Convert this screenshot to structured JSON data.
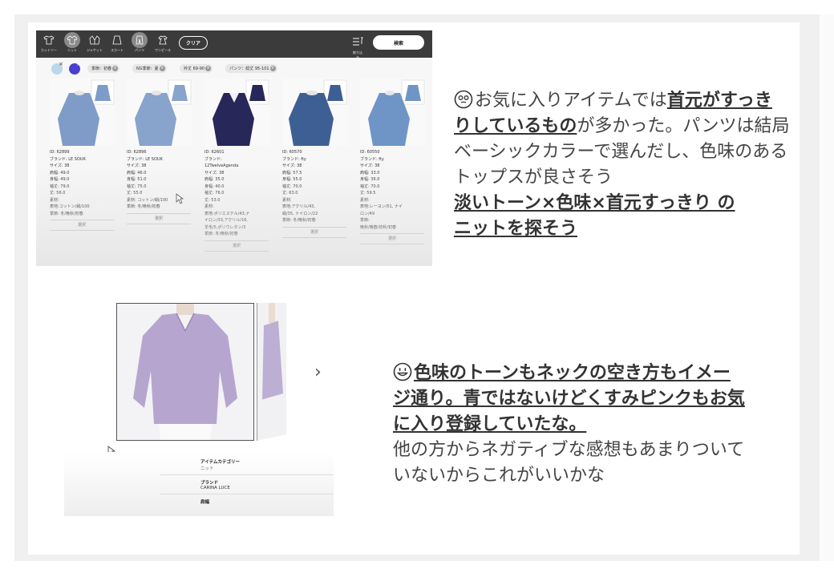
{
  "screenshot1": {
    "categories": [
      {
        "label": "カットソー",
        "icon": "tshirt-icon",
        "on": false
      },
      {
        "label": "ニット",
        "icon": "knit-icon",
        "on": true
      },
      {
        "label": "ジャケット",
        "icon": "jacket-icon",
        "on": false
      },
      {
        "label": "スカート",
        "icon": "skirt-icon",
        "on": false
      },
      {
        "label": "パンツ",
        "icon": "pants-icon",
        "on": true
      },
      {
        "label": "ワンピース",
        "icon": "dress-icon",
        "on": false
      }
    ],
    "clear_label": "クリア",
    "filter_label": "絞り込み",
    "search_label": "検索",
    "chips": [
      "季節：初春",
      "NG季節：夏",
      "衿丈 69-90",
      "パンツ：総丈 95-101"
    ],
    "products": [
      {
        "id": "ID: 62899",
        "brand": "ブランド: LE SOUK",
        "size": "サイズ: 38",
        "shoulder": "肩幅: 49.0",
        "body": "身幅: 49.0",
        "sleeve": "袖丈: 79.0",
        "length": "丈: 56.0",
        "material_label": "素材:",
        "material": "表地:コットン/絹/100",
        "season": "季節: 冬/晩秋/初春",
        "select": "選択",
        "color": "#7f9cc9"
      },
      {
        "id": "ID: 62896",
        "brand": "ブランド: LE SOUK",
        "size": "サイズ: 38",
        "shoulder": "肩幅: 46.0",
        "body": "身幅: 51.0",
        "sleeve": "袖丈: 75.0",
        "length": "丈: 55.0",
        "material_label": "素材: コットン/絹/100",
        "material": "",
        "season": "季節: 冬/晩秋/初春",
        "select": "選択",
        "color": "#88a3cc"
      },
      {
        "id": "ID: 62601",
        "brand": "ブランド:",
        "brand2": "12TwelveAgenda",
        "size": "サイズ: 38",
        "shoulder": "肩幅: 35.0",
        "body": "身幅: 40.0",
        "sleeve": "袖丈: 76.0",
        "length": "丈: 53.0",
        "material_label": "素材:",
        "material": "表地:ポリエステル/43,ナ",
        "material2": "イロン/33,アクリル/16,",
        "material3": "羊毛/5,ポリウレタン/3",
        "season": "季節: 冬/晩秋/初春",
        "select": "選択",
        "color": "#27275a"
      },
      {
        "id": "ID: 60570",
        "brand": "ブランド: fty",
        "size": "サイズ: 38",
        "shoulder": "肩幅: 57.5",
        "body": "身幅: 55.0",
        "sleeve": "袖丈: 70.0",
        "length": "丈: 63.0",
        "material_label": "素材:",
        "material": "表地:アクリル/43,",
        "material2": "絹/35, ナイロン/22",
        "season": "季節: 冬/晩秋/初春",
        "select": "選択",
        "color": "#3e5f93"
      },
      {
        "id": "ID: 60550",
        "brand": "ブランド: fty",
        "size": "サイズ: 38",
        "shoulder": "肩幅: 33.0",
        "body": "身幅: 36.0",
        "sleeve": "袖丈: 70.0",
        "length": "丈: 59.5",
        "material_label": "素材:",
        "material": "表地:レーヨン/51, ナイ",
        "material2": "ロン/49",
        "season": "季節:",
        "season2": "晩秋/晩春/初秋/初春",
        "select": "選択",
        "color": "#6f95c6"
      }
    ]
  },
  "screenshot2": {
    "category_label": "アイテムカテゴリー",
    "category_value": "ニット",
    "brand_label": "ブランド",
    "brand_value": "CARINA LUCE",
    "shoulder_label": "肩幅",
    "sweater_color": "#b6a6cf"
  },
  "note1": {
    "l1_a": "お気に入りアイテムでは",
    "l1_b": "首元がすっき",
    "l2_a": "りしているもの",
    "l2_b": "が多かった。パンツは結局",
    "l3": "ベーシックカラーで選んだし、色味のある",
    "l4": "トップスが良さそう",
    "l5": "淡いトーン×色味×首元すっきり の",
    "l6": "ニットを探そう"
  },
  "note2": {
    "l1": "色味のトーンもネックの空き方もイメー",
    "l2": "ジ通り。青ではないけどくすみピンクもお気",
    "l3": "に入り登録していたな。",
    "l4": "他の方からネガティブな感想もあまりついて",
    "l5": "いないからこれがいいかな"
  }
}
